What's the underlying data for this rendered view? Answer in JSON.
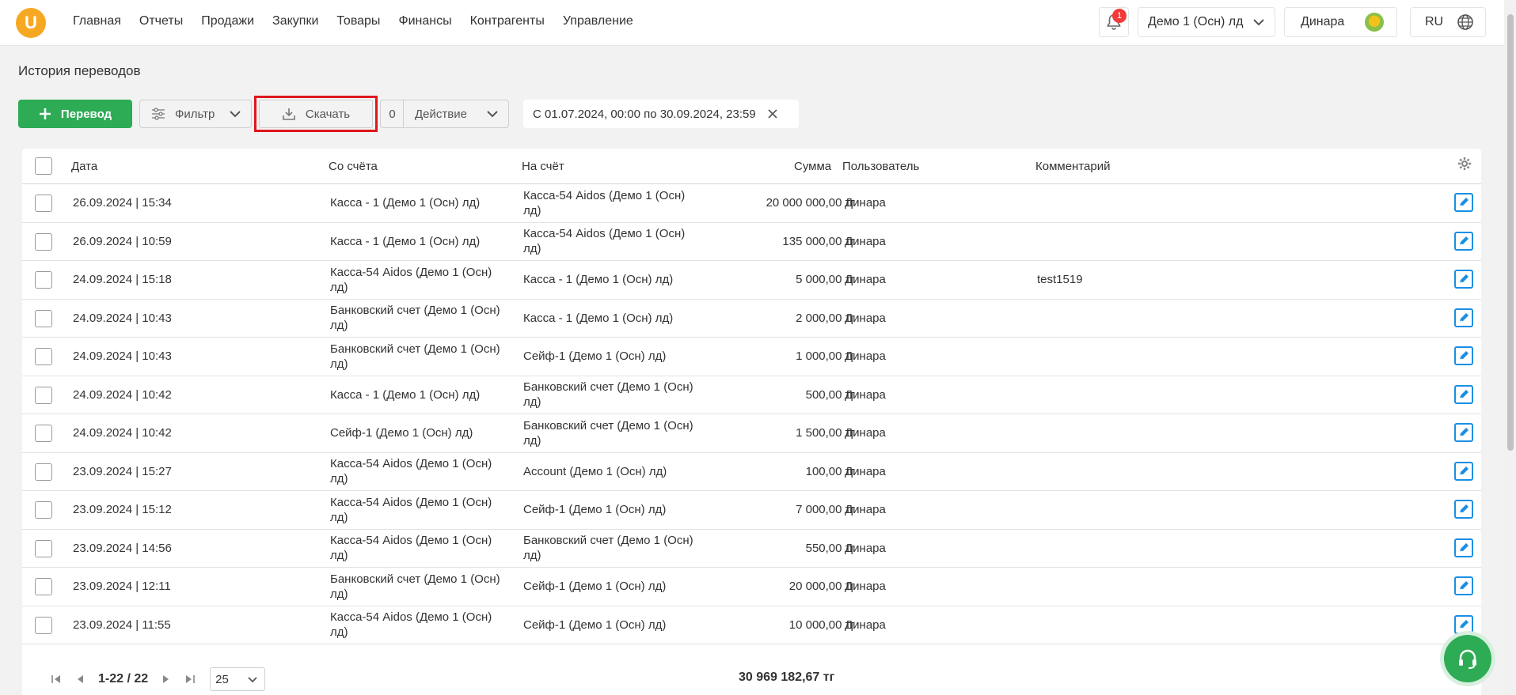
{
  "header": {
    "logo": "U",
    "nav": [
      "Главная",
      "Отчеты",
      "Продажи",
      "Закупки",
      "Товары",
      "Финансы",
      "Контрагенты",
      "Управление"
    ],
    "notifications_count": "1",
    "company": "Демо 1 (Осн) лд",
    "user_name": "Динара",
    "language": "RU"
  },
  "page_title": "История переводов",
  "toolbar": {
    "transfer_label": "Перевод",
    "filter_label": "Фильтр",
    "download_label": "Скачать",
    "selected_count": "0",
    "action_label": "Действие",
    "date_range": "С 01.07.2024, 00:00 по 30.09.2024, 23:59"
  },
  "table": {
    "headers": {
      "date": "Дата",
      "from": "Со счёта",
      "to": "На счёт",
      "sum": "Сумма",
      "user": "Пользователь",
      "comment": "Комментарий"
    },
    "rows": [
      {
        "date": "26.09.2024 | 15:34",
        "from": "Касса - 1 (Демо 1 (Осн) лд)",
        "to": "Касса-54 Aidos (Демо 1 (Осн) лд)",
        "sum": "20 000 000,00 тг",
        "user": "Динара",
        "comment": ""
      },
      {
        "date": "26.09.2024 | 10:59",
        "from": "Касса - 1 (Демо 1 (Осн) лд)",
        "to": "Касса-54 Aidos (Демо 1 (Осн) лд)",
        "sum": "135 000,00 тг",
        "user": "Динара",
        "comment": ""
      },
      {
        "date": "24.09.2024 | 15:18",
        "from": "Касса-54 Aidos (Демо 1 (Осн) лд)",
        "to": "Касса - 1 (Демо 1 (Осн) лд)",
        "sum": "5 000,00 тг",
        "user": "Динара",
        "comment": "test1519"
      },
      {
        "date": "24.09.2024 | 10:43",
        "from": "Банковский счет (Демо 1 (Осн) лд)",
        "to": "Касса - 1 (Демо 1 (Осн) лд)",
        "sum": "2 000,00 тг",
        "user": "Динара",
        "comment": ""
      },
      {
        "date": "24.09.2024 | 10:43",
        "from": "Банковский счет (Демо 1 (Осн) лд)",
        "to": "Сейф-1 (Демо 1 (Осн) лд)",
        "sum": "1 000,00 тг",
        "user": "Динара",
        "comment": ""
      },
      {
        "date": "24.09.2024 | 10:42",
        "from": "Касса - 1 (Демо 1 (Осн) лд)",
        "to": "Банковский счет (Демо 1 (Осн) лд)",
        "sum": "500,00 тг",
        "user": "Динара",
        "comment": ""
      },
      {
        "date": "24.09.2024 | 10:42",
        "from": "Сейф-1 (Демо 1 (Осн) лд)",
        "to": "Банковский счет (Демо 1 (Осн) лд)",
        "sum": "1 500,00 тг",
        "user": "Динара",
        "comment": ""
      },
      {
        "date": "23.09.2024 | 15:27",
        "from": "Касса-54 Aidos (Демо 1 (Осн) лд)",
        "to": "Account (Демо 1 (Осн) лд)",
        "sum": "100,00 тг",
        "user": "Динара",
        "comment": ""
      },
      {
        "date": "23.09.2024 | 15:12",
        "from": "Касса-54 Aidos (Демо 1 (Осн) лд)",
        "to": "Сейф-1 (Демо 1 (Осн) лд)",
        "sum": "7 000,00 тг",
        "user": "Динара",
        "comment": ""
      },
      {
        "date": "23.09.2024 | 14:56",
        "from": "Касса-54 Aidos (Демо 1 (Осн) лд)",
        "to": "Банковский счет (Демо 1 (Осн) лд)",
        "sum": "550,00 тг",
        "user": "Динара",
        "comment": ""
      },
      {
        "date": "23.09.2024 | 12:11",
        "from": "Банковский счет (Демо 1 (Осн) лд)",
        "to": "Сейф-1 (Демо 1 (Осн) лд)",
        "sum": "20 000,00 тг",
        "user": "Динара",
        "comment": ""
      },
      {
        "date": "23.09.2024 | 11:55",
        "from": "Касса-54 Aidos (Демо 1 (Осн) лд)",
        "to": "Сейф-1 (Демо 1 (Осн) лд)",
        "sum": "10 000,00 тг",
        "user": "Динара",
        "comment": ""
      }
    ]
  },
  "footer": {
    "range": "1-22 / 22",
    "per_page": "25",
    "total": "30 969 182,67 тг"
  },
  "colors": {
    "brand": "#f7a823",
    "primary": "#2eab55",
    "edit": "#1a8fe3",
    "highlight": "#e0161c"
  }
}
